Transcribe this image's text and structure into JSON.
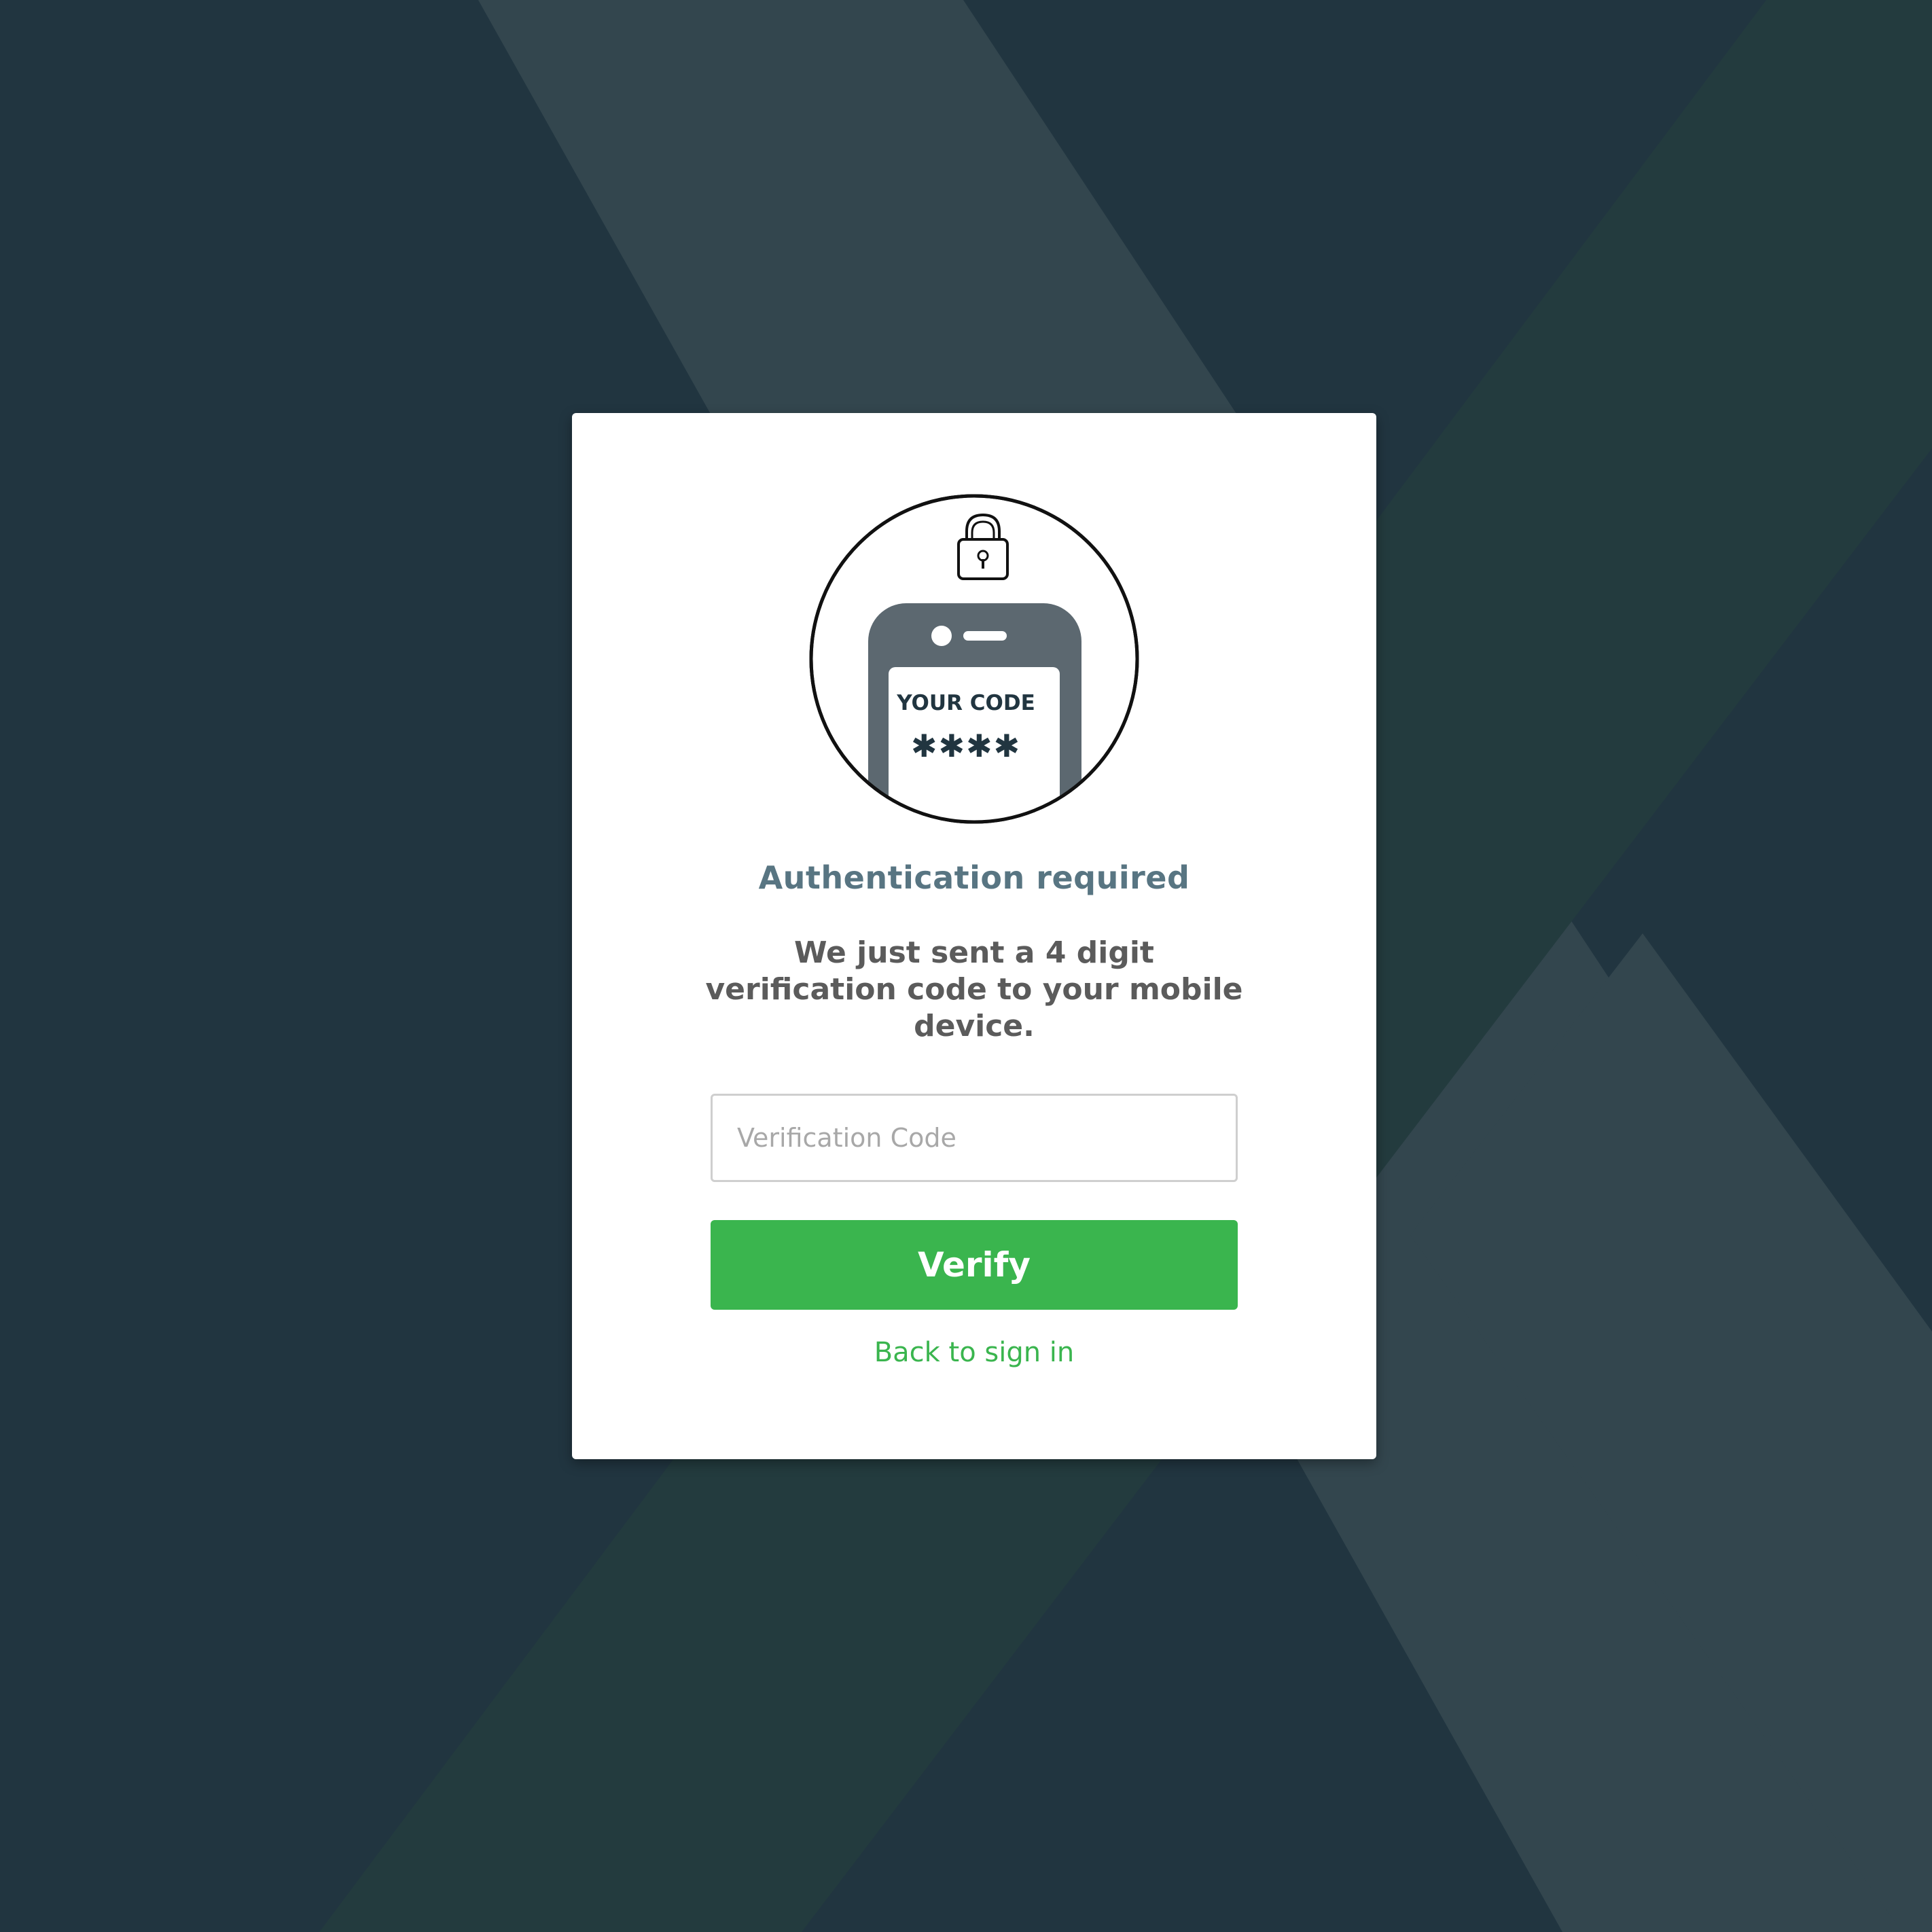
{
  "background": {
    "base_color": "#213540",
    "stripe_light": "#33464e",
    "stripe_green": "#233b3e"
  },
  "illustration": {
    "lock_icon": "padlock-icon",
    "phone_icon": "mobile-phone-icon",
    "screen_label": "YOUR CODE",
    "screen_code": "✱✱✱✱"
  },
  "auth": {
    "title": "Authentication required",
    "message": "We just sent a 4 digit verification code to your mobile device.",
    "code_placeholder": "Verification Code",
    "code_value": "",
    "verify_label": "Verify",
    "back_label": "Back to sign in"
  },
  "colors": {
    "accent": "#3ab54e",
    "title": "#587582",
    "text": "#5b5b5b"
  }
}
